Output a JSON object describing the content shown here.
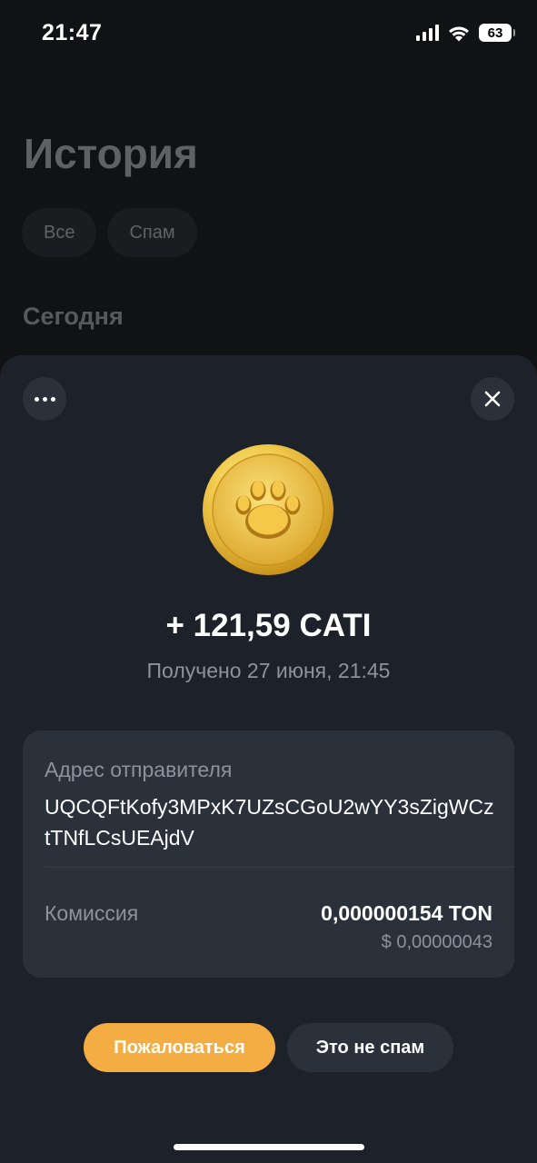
{
  "status_bar": {
    "time": "21:47",
    "battery": "63"
  },
  "history": {
    "title": "История",
    "filters": [
      "Все",
      "Спам"
    ],
    "section": "Сегодня"
  },
  "transaction": {
    "amount": "+ 121,59 CATI",
    "received": "Получено 27 июня, 21:45",
    "sender_label": "Адрес отправителя",
    "sender_address": "UQCQFtKofy3MPxK7UZsCGoU2wYY3sZigWCztTNfLCsUEAjdV",
    "fee_label": "Комиссия",
    "fee_value": "0,000000154 TON",
    "fee_usd": "$ 0,00000043"
  },
  "actions": {
    "report": "Пожаловаться",
    "not_spam": "Это не спам"
  },
  "icons": {
    "more": "more-horizontal-icon",
    "close": "close-icon",
    "token": "paw-coin-icon"
  },
  "colors": {
    "accent": "#f4ad42",
    "sheet_bg": "#1d222a",
    "card_bg": "#2a313b",
    "secondary_text": "#8b939e"
  }
}
